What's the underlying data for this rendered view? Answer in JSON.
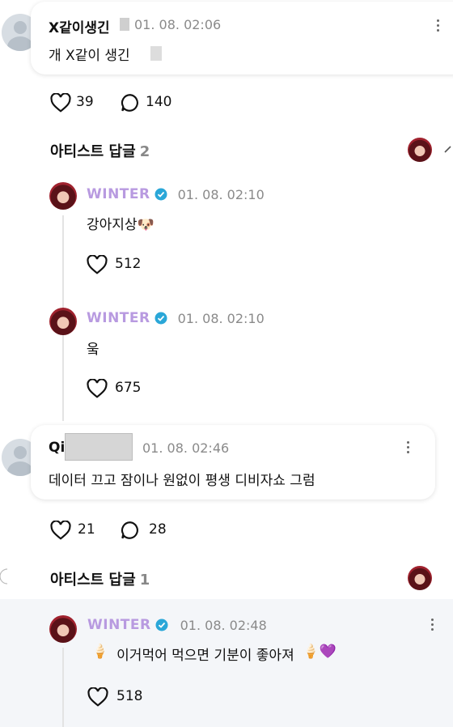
{
  "comments": [
    {
      "user": "X같이생긴",
      "time": "01. 08. 02:06",
      "text": "개 X같이 생긴",
      "likes": "39",
      "replies": "140",
      "artist_header": {
        "label": "아티스트 답글",
        "count": "2"
      }
    },
    {
      "user": "Qi",
      "time": "01. 08. 02:46",
      "text": "데이터 끄고 잠이나 원없이 평생 디비자쇼 그럼",
      "likes": "21",
      "replies": "28",
      "artist_header": {
        "label": "아티스트 답글",
        "count": "1"
      }
    }
  ],
  "artist_replies": [
    {
      "name": "WINTER",
      "time": "01. 08. 02:10",
      "text": "강아지상",
      "emoji": "🐶",
      "likes": "512"
    },
    {
      "name": "WINTER",
      "time": "01. 08. 02:10",
      "text": "웈",
      "likes": "675"
    },
    {
      "name": "WINTER",
      "time": "01. 08. 02:48",
      "text": "이거먹어 먹으면 기분이 좋아져",
      "emoji_lead": "🍦",
      "emoji_trail": "🍦💜",
      "likes": "518"
    }
  ],
  "icons": {
    "heart": "heart-icon",
    "comment": "comment-icon",
    "verified": "verified-badge-icon",
    "more": "more-vertical-icon"
  },
  "colors": {
    "artist_name": "#b89ae0",
    "verified": "#2aa7d8",
    "highlight_bg": "#f4f6f9"
  }
}
